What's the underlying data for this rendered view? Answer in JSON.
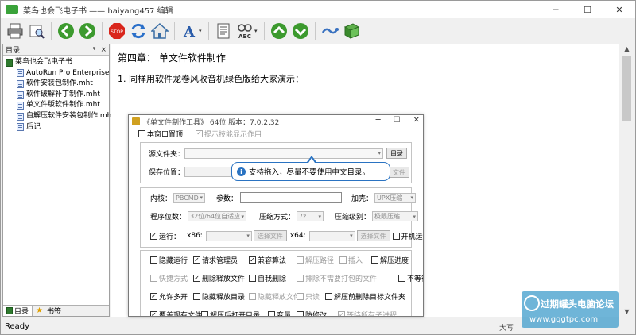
{
  "window": {
    "title": "菜鸟也会飞电子书 —— haiyang457 编辑",
    "controls": {
      "minimize": "─",
      "maximize": "☐",
      "close": "✕"
    }
  },
  "toolbar": {
    "icons": [
      "print-icon",
      "print-preview-icon",
      "back-icon",
      "forward-icon",
      "stop-icon",
      "refresh-icon",
      "home-icon",
      "font-icon",
      "contents-icon",
      "spell-check-icon",
      "up-icon",
      "down-icon",
      "link-icon",
      "book-icon"
    ],
    "stop_label": "STOP",
    "font_glyph": "A",
    "spell_label": "ABC",
    "dropdown_glyph": "▾"
  },
  "sidebar": {
    "title": "目录",
    "pin": "ᵠ",
    "close": "×",
    "root": "菜鸟也会飞电子书",
    "items": [
      "AutoRun Pro Enterprise II.r",
      "软件安装包制作.mht",
      "软件破解补丁制作.mht",
      "单文件版软件制作.mht",
      "自解压软件安装包制作.mht",
      "后记"
    ],
    "tabs": [
      "目录",
      "书签"
    ]
  },
  "content": {
    "chapter_title": "第四章： 单文件软件制作",
    "paragraph": "1. 同样用软件龙卷风收音机绿色版给大家演示："
  },
  "scroll": {
    "up": "▲",
    "down": "▼"
  },
  "status": {
    "text": "Ready",
    "caps": "大写"
  },
  "dialog": {
    "title": "《单文件制作工具》 64位 版本：7.0.2.32",
    "controls": {
      "minimize": "─",
      "maximize": "☐",
      "close": "✕"
    },
    "topmost": "本窗口置顶",
    "tips": "提示技能显示作用",
    "source_label": "源文件夹：",
    "dir_btn": "目录",
    "save_label": "保存位置：",
    "file_btn_partial": "文件",
    "kernel_label": "内核：",
    "kernel_value": "PBCMD",
    "params_label": "参数：",
    "pack_label": "加壳：",
    "pack_value": "UPX压缩",
    "arch_label": "程序位数：",
    "arch_value": "32位/64位自适应",
    "compress_label": "压缩方式：",
    "compress_value": "7z",
    "level_label": "压缩级别：",
    "level_value": "极限压缩",
    "run_label": "运行：",
    "x86_label": "x86:",
    "x64_label": "x64:",
    "choose_file": "选择文件",
    "autostart": "开机运行",
    "options_row1": [
      "隐藏运行",
      "请求管理员",
      "兼容算法",
      "解压路径",
      "插入",
      "解压进度"
    ],
    "options_row2": [
      "快捷方式",
      "删除释放文件",
      "自我删除",
      "排除不需要打包的文件",
      "不等待"
    ],
    "options_row3": [
      "允许多开",
      "隐藏释放目录",
      "隐藏释放文件",
      "只读",
      "解压前删除目标文件夹"
    ],
    "options_row4": [
      "覆盖现有文件",
      "解压后打开目录",
      "变量",
      "防修改",
      "等待所有子进程"
    ],
    "check": "✓"
  },
  "tooltip": {
    "icon": "i",
    "text": "支持拖入，尽量不要使用中文目录。"
  },
  "watermark": {
    "line1": "过期罐头电脑论坛",
    "line2": "www.gqgtpc.com"
  }
}
